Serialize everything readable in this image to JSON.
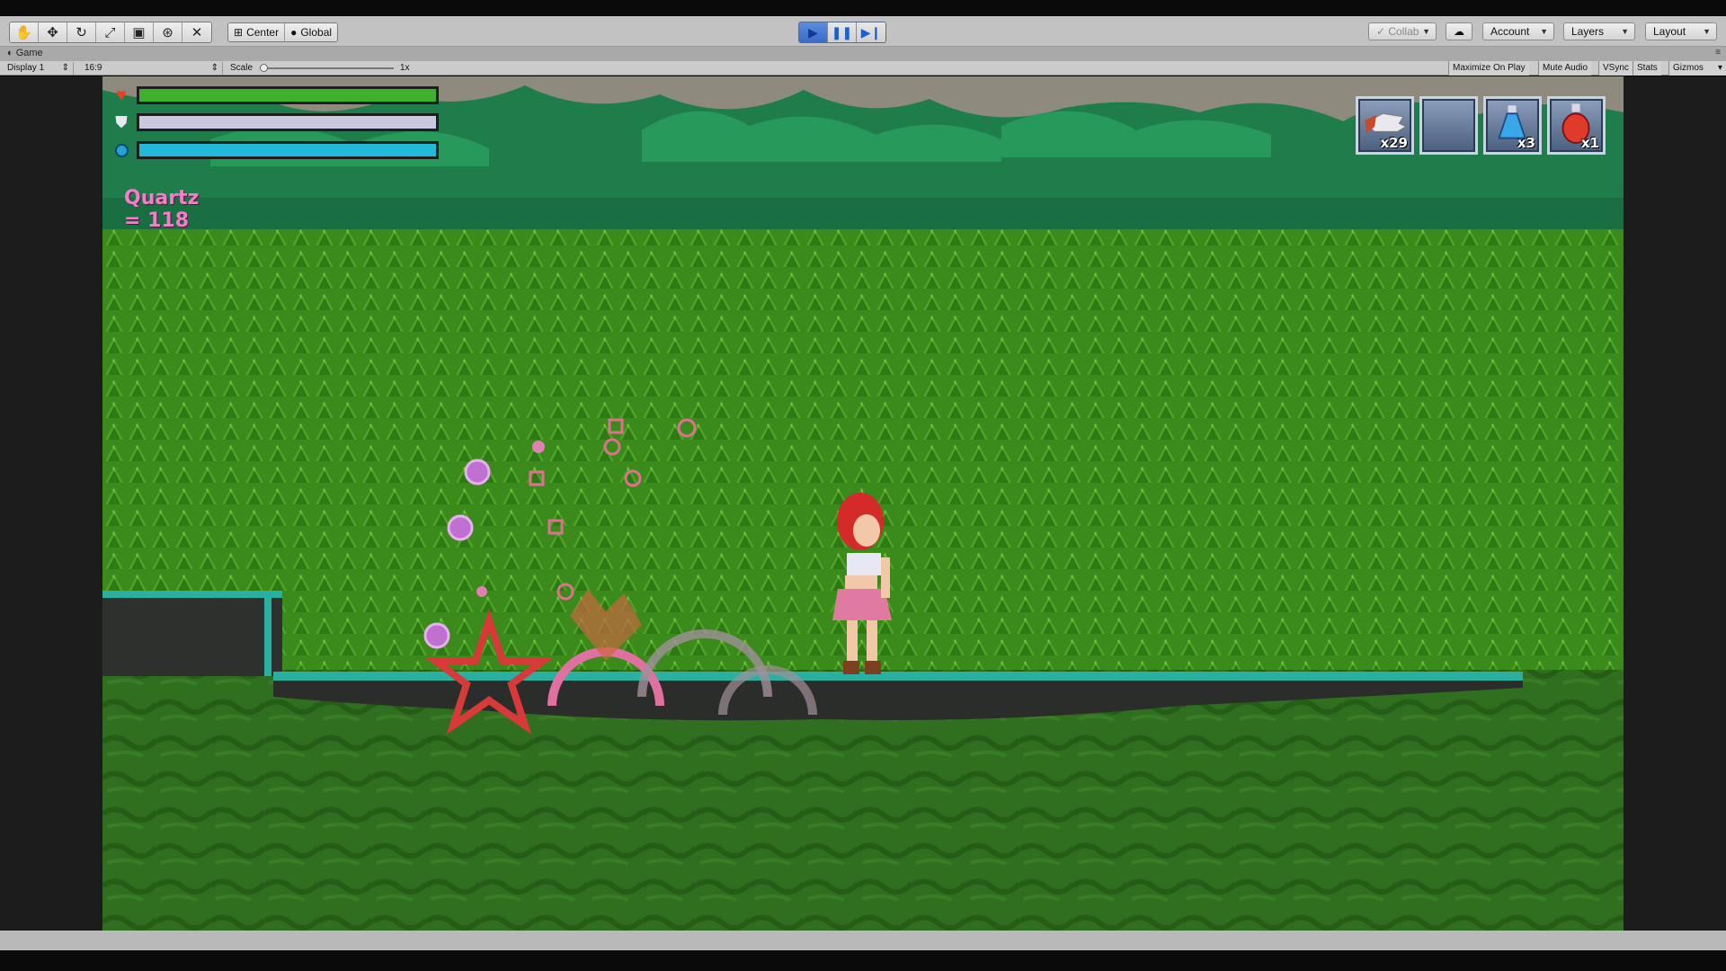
{
  "toolbar": {
    "tools": [
      "hand-tool",
      "move-tool",
      "rotate-tool",
      "scale-tool",
      "rect-tool",
      "transform-tool",
      "custom-tool"
    ],
    "pivot_label": "Center",
    "space_label": "Global",
    "collab_label": "Collab",
    "account_label": "Account",
    "layers_label": "Layers",
    "layout_label": "Layout"
  },
  "game_view": {
    "tab_label": "Game",
    "display_label": "Display 1",
    "aspect_label": "16:9",
    "scale_label": "Scale",
    "scale_value": "1x",
    "maximize_label": "Maximize On Play",
    "mute_label": "Mute Audio",
    "vsync_label": "VSync",
    "stats_label": "Stats",
    "gizmos_label": "Gizmos"
  },
  "hud": {
    "health": {
      "fill": 1.0,
      "color": "#3fb02e"
    },
    "armor": {
      "fill": 1.0,
      "color": "#c8c8e0"
    },
    "mana": {
      "fill": 1.0,
      "color": "#22b8d8"
    },
    "quartz_text": "Quartz = 118"
  },
  "inventory": [
    {
      "item": "wings-icon",
      "qty": "x29"
    },
    {
      "item": "empty-slot",
      "qty": ""
    },
    {
      "item": "blue-potion-icon",
      "qty": "x3"
    },
    {
      "item": "red-potion-icon",
      "qty": "x1"
    }
  ],
  "colors": {
    "sky": "#1f7a4a",
    "forest": "#3d8a1e",
    "ground": "#2d6f1e",
    "ledge": "#2ab0a0"
  }
}
